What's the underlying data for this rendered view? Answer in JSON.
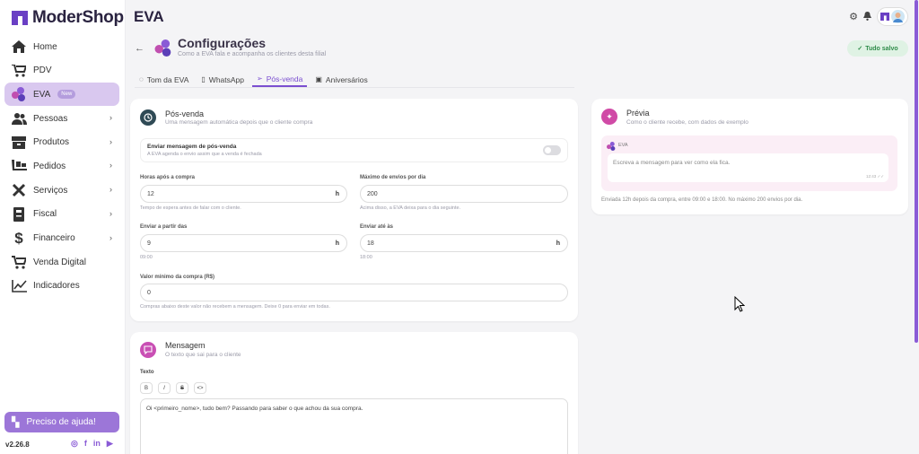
{
  "brand": {
    "name": "ModerShop"
  },
  "header": {
    "title": "EVA"
  },
  "sidebar": {
    "items": [
      {
        "label": "Home",
        "icon": "home-icon",
        "chevron": false
      },
      {
        "label": "PDV",
        "icon": "cart-icon",
        "chevron": false
      },
      {
        "label": "EVA",
        "icon": "eva-icon",
        "chevron": false,
        "badge": "New",
        "active": true
      },
      {
        "label": "Pessoas",
        "icon": "people-icon",
        "chevron": true
      },
      {
        "label": "Produtos",
        "icon": "box-icon",
        "chevron": true
      },
      {
        "label": "Pedidos",
        "icon": "orders-icon",
        "chevron": true
      },
      {
        "label": "Serviços",
        "icon": "tools-icon",
        "chevron": true
      },
      {
        "label": "Fiscal",
        "icon": "fiscal-icon",
        "chevron": true
      },
      {
        "label": "Financeiro",
        "icon": "dollar-icon",
        "chevron": true
      },
      {
        "label": "Venda Digital",
        "icon": "digital-cart-icon",
        "chevron": false
      },
      {
        "label": "Indicadores",
        "icon": "chart-icon",
        "chevron": false
      }
    ],
    "help_label": "Preciso de ajuda!",
    "version": "v2.26.8"
  },
  "page": {
    "title": "Configurações",
    "subtitle": "Como a EVA fala e acompanha os clientes desta filial",
    "saved_label": "Tudo salvo"
  },
  "tabs": [
    {
      "label": "Tom da EVA",
      "icon": "chat-icon",
      "active": false
    },
    {
      "label": "WhatsApp",
      "icon": "phone-icon",
      "active": false
    },
    {
      "label": "Pós-venda",
      "icon": "send-icon",
      "active": true
    },
    {
      "label": "Aniversários",
      "icon": "gift-icon",
      "active": false
    }
  ],
  "posvenda": {
    "title": "Pós-venda",
    "subtitle": "Uma mensagem automática depois que o cliente compra",
    "toggle_title": "Enviar mensagem de pós-venda",
    "toggle_desc": "A EVA agenda o envio assim que a venda é fechada",
    "toggle_on": false,
    "fields": {
      "horas_label": "Horas após a compra",
      "horas_value": "12",
      "horas_unit": "h",
      "horas_help": "Tempo de espera antes de falar com o cliente.",
      "max_label": "Máximo de envios por dia",
      "max_value": "200",
      "max_help": "Acima disso, a EVA deixa para o dia seguinte.",
      "inicio_label": "Enviar a partir das",
      "inicio_value": "9",
      "inicio_unit": "h",
      "inicio_help": "09:00",
      "fim_label": "Enviar até às",
      "fim_value": "18",
      "fim_unit": "h",
      "fim_help": "18:00",
      "valor_label": "Valor mínimo da compra (R$)",
      "valor_value": "0",
      "valor_help": "Compras abaixo deste valor não recebem a mensagem. Deixe 0 para enviar em todas."
    }
  },
  "mensagem": {
    "title": "Mensagem",
    "subtitle": "O texto que sai para o cliente",
    "text_label": "Texto",
    "format_buttons": [
      "B",
      "I",
      "S",
      "<>"
    ],
    "text_value": "Oi <primeiro_nome>, tudo bem? Passando para saber o que achou da sua compra."
  },
  "preview": {
    "title": "Prévia",
    "subtitle": "Como o cliente recebe, com dados de exemplo",
    "sender": "EVA",
    "bubble_text": "Escreva a mensagem para ver como ela fica.",
    "bubble_time": "12:43 ✓✓",
    "footer": "Enviada 12h depois da compra, entre 09:00 e 18:00. No máximo 200 envios por dia."
  },
  "colors": {
    "accent": "#7b4fd0",
    "active_bg": "#d9c8ef",
    "help_bg": "#9c76d8",
    "saved_bg": "#dff2e4",
    "saved_text": "#2f8c4a"
  }
}
